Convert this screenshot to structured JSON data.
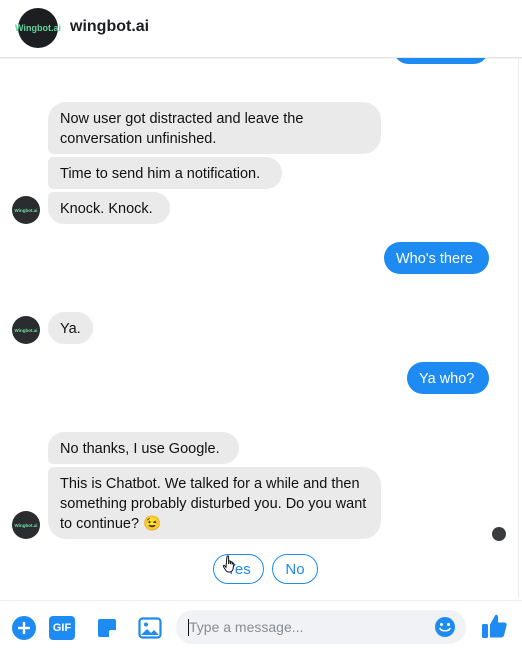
{
  "header": {
    "logo_text": "Wingbot.ai",
    "title": "wingbot.ai"
  },
  "avatar_text": "Wingbot.ai",
  "messages": {
    "m1": "Now user got distracted and leave the conversation unfinished.",
    "m2": "Time to send him a notification.",
    "m3": "Knock. Knock.",
    "m4": "Who's there",
    "m5": "Ya.",
    "m6": "Ya who?",
    "m7": "No thanks, I use Google.",
    "m8": "This is Chatbot. We talked for a while and then something probably disturbed you. Do you want to continue? 😉"
  },
  "quick_replies": {
    "yes": "Yes",
    "no": "No"
  },
  "composer": {
    "placeholder": "Type a message...",
    "gif": "GIF"
  },
  "colors": {
    "accent": "#1d8bf1",
    "bubble_in": "#eaeaea",
    "logo_text": "#5ed59a"
  }
}
